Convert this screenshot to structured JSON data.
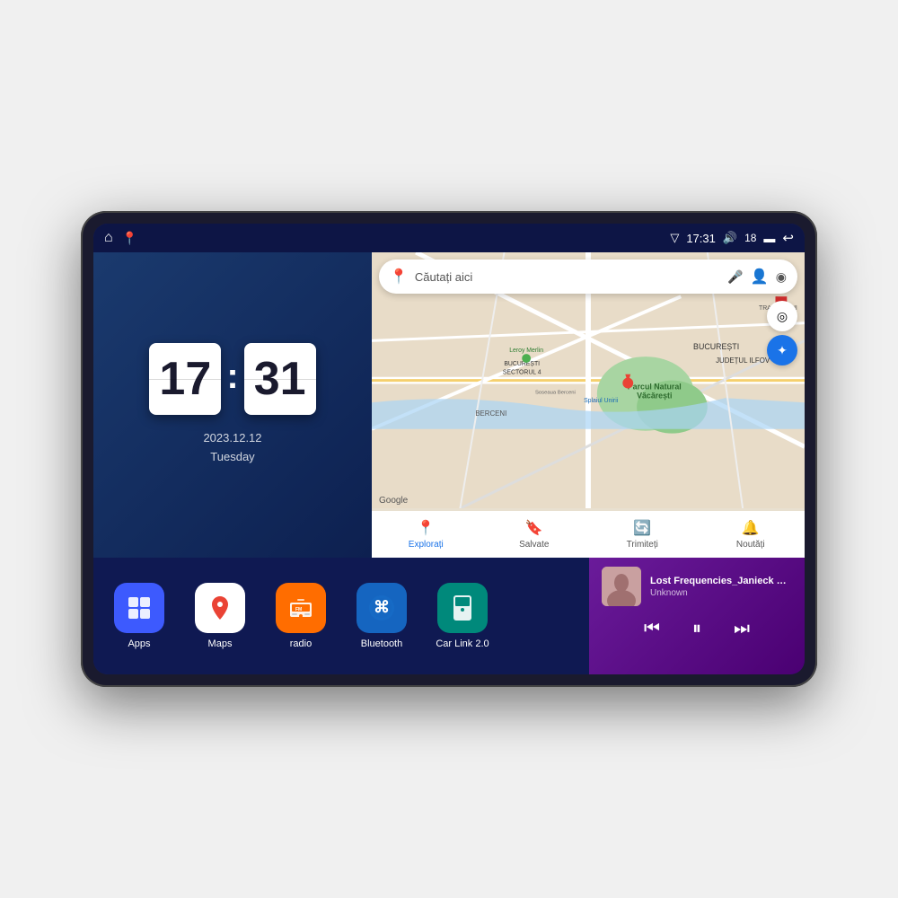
{
  "device": {
    "screen": {
      "statusBar": {
        "leftIcons": [
          "home-icon",
          "maps-icon"
        ],
        "time": "17:31",
        "batteryIcon": "battery-icon",
        "batteryLevel": "18",
        "wifiIcon": "wifi-icon",
        "backIcon": "back-icon",
        "signalIcon": "signal-icon"
      },
      "clock": {
        "hours": "17",
        "minutes": "31",
        "date": "2023.12.12",
        "day": "Tuesday"
      },
      "map": {
        "searchPlaceholder": "Căutați aici",
        "googleLogo": "Google",
        "navItems": [
          {
            "label": "Explorați",
            "icon": "📍",
            "active": true
          },
          {
            "label": "Salvate",
            "icon": "🔖",
            "active": false
          },
          {
            "label": "Trimiteți",
            "icon": "🔄",
            "active": false
          },
          {
            "label": "Noutăți",
            "icon": "🔔",
            "active": false
          }
        ],
        "locations": [
          "Parcul Natural Văcărești",
          "Leroy Merlin",
          "BUCUREȘTI SECTORUL 4",
          "BERCENI",
          "TRAPEZULUI",
          "BUCUREȘTI",
          "JUDEȚUL ILFOV",
          "Splaiul Unirii"
        ]
      },
      "apps": [
        {
          "label": "Apps",
          "icon": "⊞",
          "color": "#3d5afe"
        },
        {
          "label": "Maps",
          "icon": "📍",
          "color": "#ffffff"
        },
        {
          "label": "radio",
          "icon": "📻",
          "color": "#ff6d00"
        },
        {
          "label": "Bluetooth",
          "icon": "🔷",
          "color": "#1565c0"
        },
        {
          "label": "Car Link 2.0",
          "icon": "📱",
          "color": "#00897b"
        }
      ],
      "music": {
        "title": "Lost Frequencies_Janieck Devy-...",
        "artist": "Unknown",
        "controls": {
          "prev": "⏮",
          "play": "⏸",
          "next": "⏭"
        }
      }
    }
  }
}
